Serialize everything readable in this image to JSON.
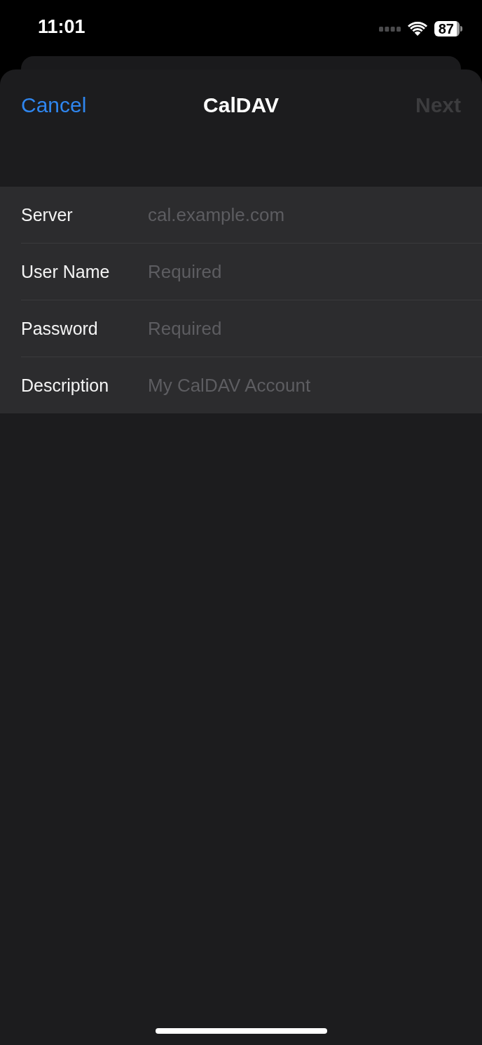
{
  "status_bar": {
    "time": "11:01",
    "battery": "87"
  },
  "nav": {
    "cancel": "Cancel",
    "title": "CalDAV",
    "next": {
      "label": "Next",
      "disabled": true
    }
  },
  "fields": [
    {
      "label": "Server",
      "placeholder": "cal.example.com"
    },
    {
      "label": "User Name",
      "placeholder": "Required"
    },
    {
      "label": "Password",
      "placeholder": "Required"
    },
    {
      "label": "Description",
      "placeholder": "My CalDAV Account"
    }
  ]
}
